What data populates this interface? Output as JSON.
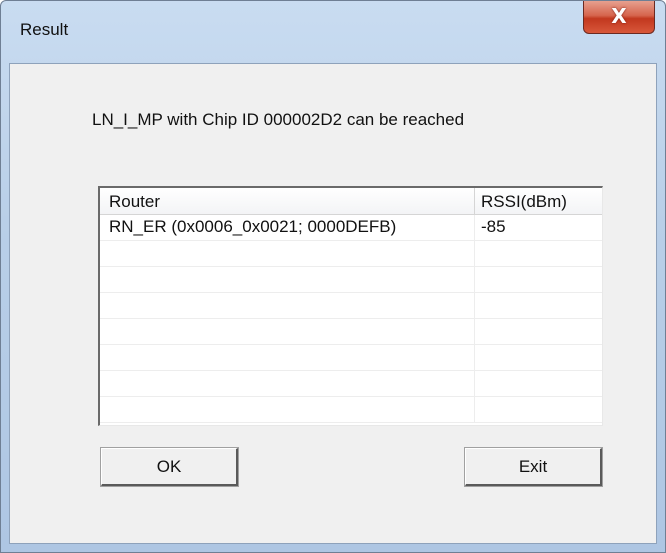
{
  "window": {
    "title": "Result",
    "close_label": "X"
  },
  "message": "LN_I_MP with Chip ID 000002D2 can be reached",
  "table": {
    "columns": [
      "Router",
      "RSSI(dBm)"
    ],
    "rows": [
      {
        "router": "RN_ER (0x0006_0x0021; 0000DEFB)",
        "rssi": "-85"
      },
      {
        "router": "",
        "rssi": ""
      },
      {
        "router": "",
        "rssi": ""
      },
      {
        "router": "",
        "rssi": ""
      },
      {
        "router": "",
        "rssi": ""
      },
      {
        "router": "",
        "rssi": ""
      },
      {
        "router": "",
        "rssi": ""
      },
      {
        "router": "",
        "rssi": ""
      }
    ]
  },
  "buttons": {
    "ok_label": "OK",
    "exit_label": "Exit"
  }
}
